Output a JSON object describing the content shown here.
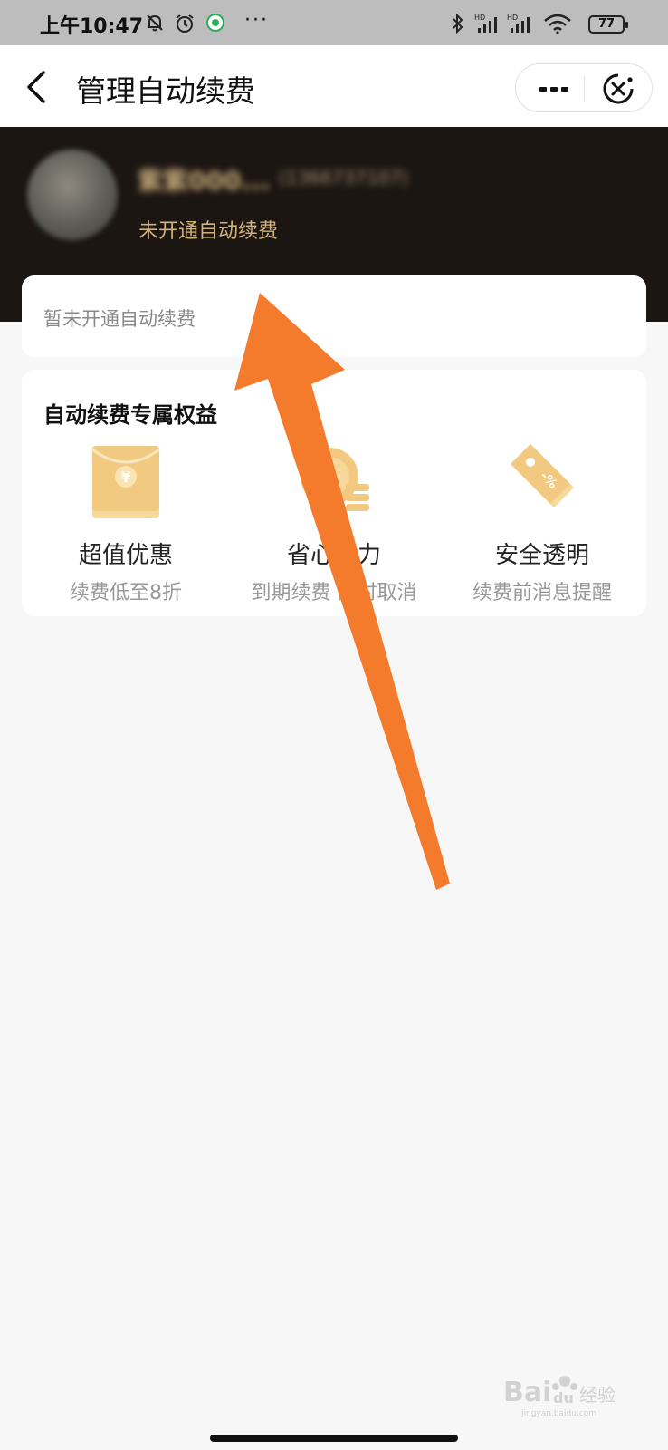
{
  "status_bar": {
    "time": "上午10:47",
    "battery": "77",
    "dots": "···"
  },
  "nav": {
    "title": "管理自动续费"
  },
  "profile": {
    "name": "紫紫000...",
    "phone": "(1366737107)",
    "status": "未开通自动续费"
  },
  "empty_notice": "暂未开通自动续费",
  "benefits": {
    "heading": "自动续费专属权益",
    "items": [
      {
        "title": "超值优惠",
        "desc": "续费低至8折",
        "icon": "red-envelope-icon"
      },
      {
        "title": "省心省力",
        "desc": "到期续费 随时取消",
        "icon": "coin-stack-icon"
      },
      {
        "title": "安全透明",
        "desc": "续费前消息提醒",
        "icon": "discount-tag-icon"
      }
    ]
  },
  "watermark": {
    "text": "经验",
    "sub": "jingyan.baidu.com"
  },
  "colors": {
    "accent": "#d4b27a",
    "hero_bg": "#1c1612",
    "arrow": "#f47a2c",
    "icon_gold": "#f2c980"
  }
}
